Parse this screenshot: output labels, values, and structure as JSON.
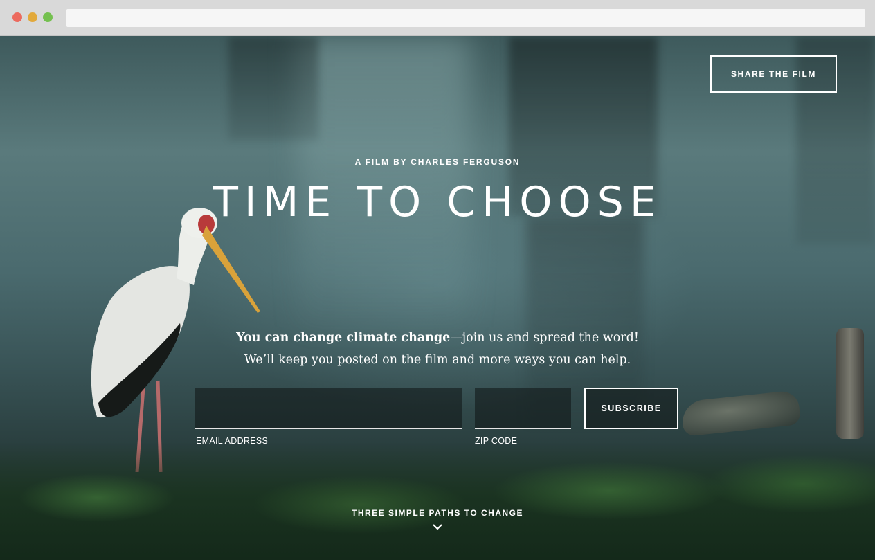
{
  "browser": {
    "url": ""
  },
  "header": {
    "share_label": "SHARE THE FILM"
  },
  "hero": {
    "byline": "A FILM BY CHARLES FERGUSON",
    "title": "TIME TO CHOOSE",
    "tagline_bold": "You can change climate change",
    "tagline_rest": "—join us and spread the word!",
    "tagline_line2": "We’ll keep you posted on the film and more ways you can help."
  },
  "form": {
    "email_value": "",
    "email_label": "EMAIL ADDRESS",
    "zip_value": "",
    "zip_label": "ZIP CODE",
    "subscribe_label": "SUBSCRIBE"
  },
  "footer": {
    "paths_label": "THREE SIMPLE PATHS TO CHANGE",
    "chevron_icon": "chevron-down-icon"
  },
  "colors": {
    "text": "#ffffff",
    "traffic_red": "#ec6a5e",
    "traffic_yellow": "#e2a93b",
    "traffic_green": "#74c04f"
  }
}
